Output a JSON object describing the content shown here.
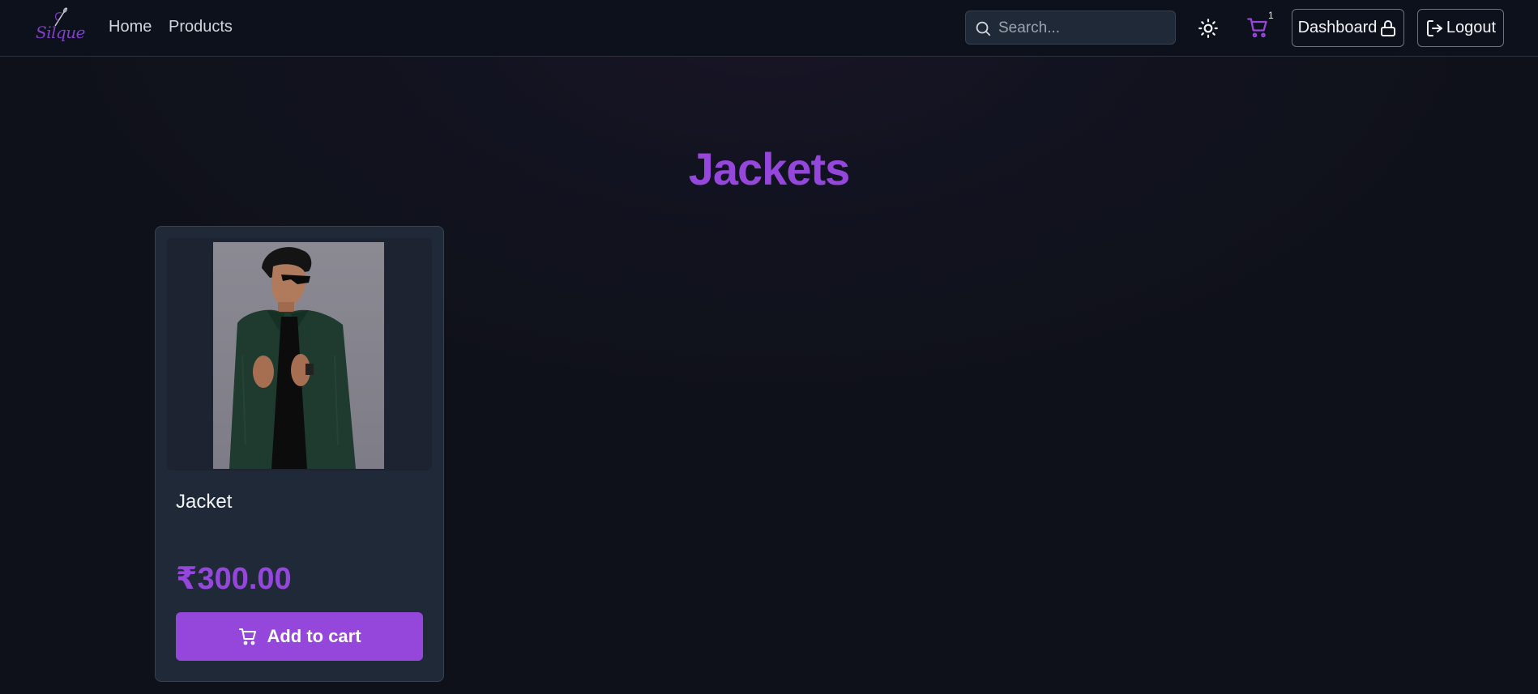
{
  "brand": {
    "logo_text": "Silque"
  },
  "nav": {
    "home_label": "Home",
    "products_label": "Products"
  },
  "search": {
    "placeholder": "Search..."
  },
  "header": {
    "cart_count": "1",
    "dashboard_label": "Dashboard",
    "logout_label": "Logout",
    "theme_icon": "sun-icon",
    "cart_icon": "cart-icon"
  },
  "page": {
    "title": "Jackets"
  },
  "products": [
    {
      "name": "Jacket",
      "price": "₹300.00",
      "button_label": "Add to cart"
    }
  ],
  "colors": {
    "accent": "#9447da",
    "background": "#0f111a",
    "card": "#1f2937"
  }
}
